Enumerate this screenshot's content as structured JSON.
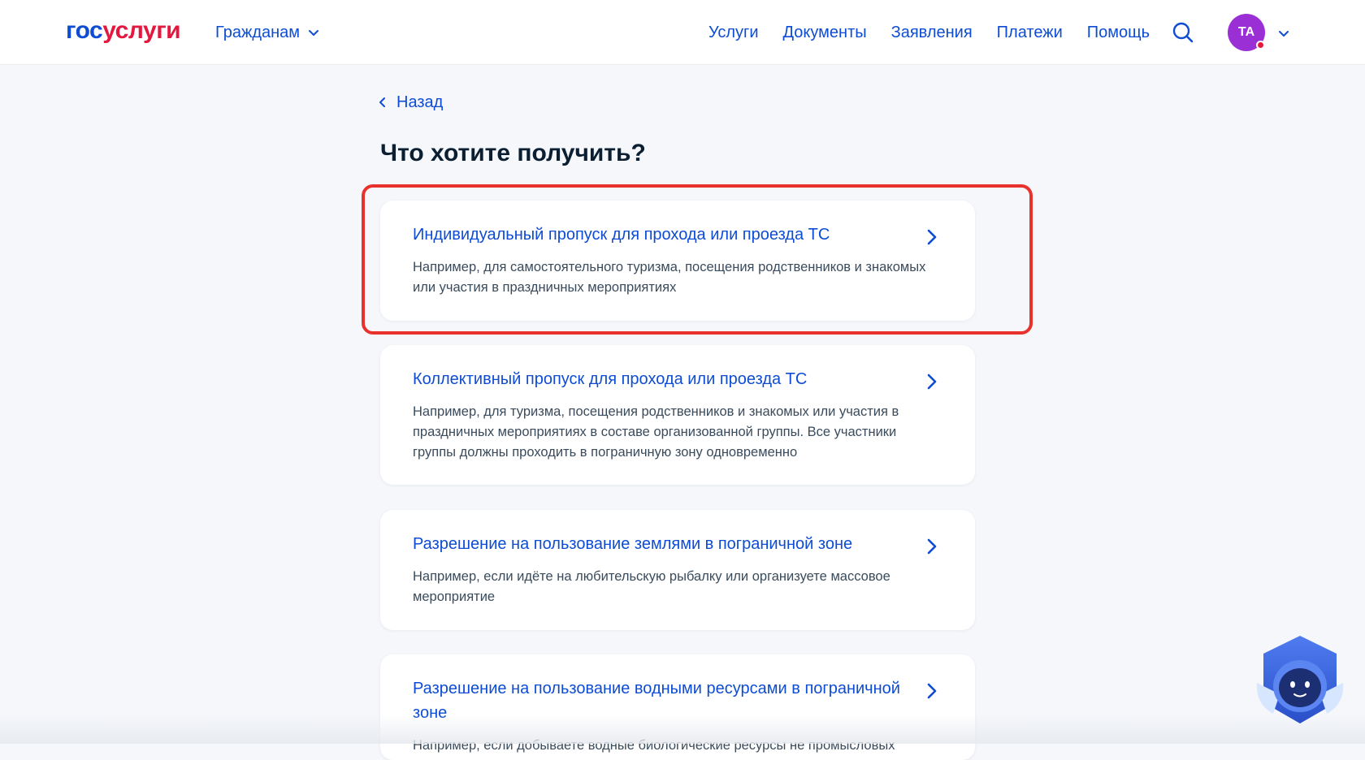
{
  "header": {
    "logo_part1": "гос",
    "logo_part2": "услуги",
    "audience_label": "Гражданам",
    "nav": [
      "Услуги",
      "Документы",
      "Заявления",
      "Платежи",
      "Помощь"
    ],
    "avatar_initials": "ТА"
  },
  "main": {
    "back_label": "Назад",
    "title": "Что хотите получить?",
    "cards": [
      {
        "title": "Индивидуальный пропуск для прохода или проезда ТС",
        "desc": "Например, для самостоятельного туризма, посещения родственников и знакомых или участия в праздничных мероприятиях"
      },
      {
        "title": "Коллективный пропуск для прохода или проезда ТС",
        "desc": "Например, для туризма, посещения родственников и знакомых или участия в праздничных мероприятиях в составе организованной группы. Все участники группы должны проходить в пограничную зону одновременно"
      },
      {
        "title": "Разрешение на пользование землями в пограничной зоне",
        "desc": "Например, если идёте на любительскую рыбалку или организуете массовое мероприятие"
      },
      {
        "title": "Разрешение на пользование водными ресурсами в пограничной зоне",
        "desc": "Например, если добываете водные биологические ресурсы не промысловых"
      }
    ]
  },
  "colors": {
    "brand_blue": "#0d4cd3",
    "brand_red": "#e4173f",
    "avatar_bg": "#9b2fd6",
    "highlight": "#e8322b",
    "page_bg": "#f5f7fb"
  },
  "icons": [
    "chevron-down-icon",
    "search-icon",
    "chevron-left-icon",
    "chevron-right-icon",
    "assistant-robot-icon"
  ]
}
